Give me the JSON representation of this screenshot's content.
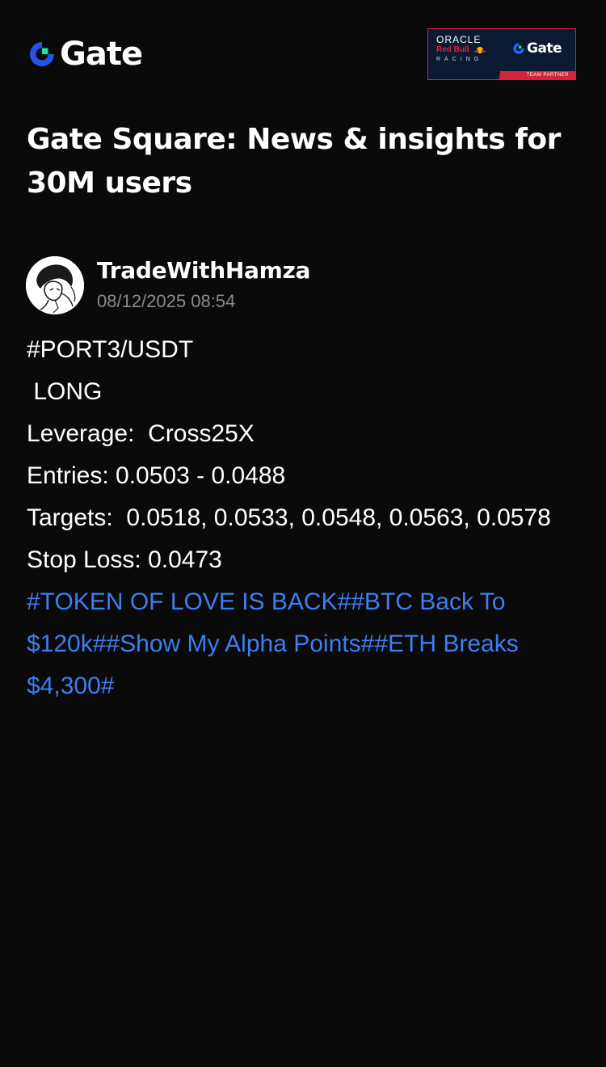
{
  "header": {
    "logo_text": "Gate",
    "partner": {
      "oracle": "ORACLE",
      "red_bull": "Red Bull",
      "racing": "RACING",
      "gate_text": "Gate",
      "strip_text": "TEAM PARTNER"
    }
  },
  "page": {
    "title": "Gate Square: News & insights for 30M users"
  },
  "post": {
    "author": "TradeWithHamza",
    "timestamp": "08/12/2025 08:54",
    "lines": [
      "#PORT3/USDT",
      " LONG",
      "Leverage:  Cross25X",
      "Entries: 0.0503 - 0.0488",
      "Targets:  0.0518, 0.0533, 0.0548, 0.0563, 0.0578",
      "Stop Loss: 0.0473"
    ],
    "hashtags": [
      "#TOKEN OF LOVE IS BACK#",
      "#BTC Back To $120k#",
      "#Show My Alpha Points#",
      "#ETH Breaks $4,300#"
    ]
  },
  "colors": {
    "background": "#0a0a0b",
    "text": "#ffffff",
    "muted": "#8a8a8f",
    "link": "#3d7ef0",
    "brand_blue": "#2354e6",
    "brand_green": "#17e6a1"
  },
  "icons": {
    "logo": "gate-logo-icon",
    "partner_logo": "gate-logo-icon",
    "bull": "red-bull-icon",
    "avatar": "user-avatar"
  }
}
